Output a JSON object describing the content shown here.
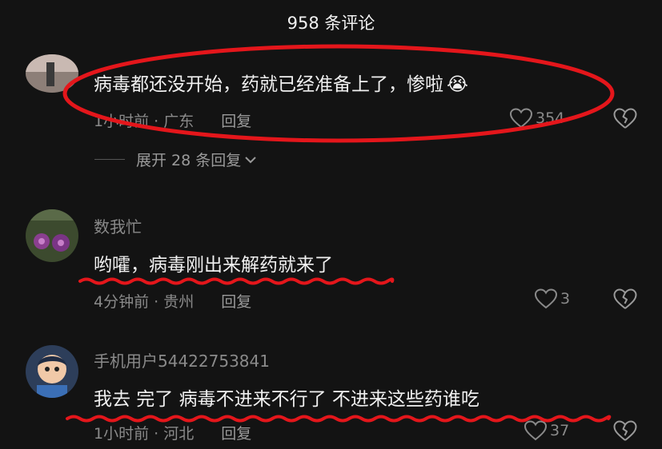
{
  "header": {
    "title": "958 条评论"
  },
  "comments": [
    {
      "username": "",
      "text": "病毒都还没开始，药就已经准备上了，惨啦",
      "emoji": "😭",
      "time": "1小时前",
      "location": "广东",
      "reply_label": "回复",
      "likes": "354",
      "expand_label": "展开 28 条回复"
    },
    {
      "username": "数我忙",
      "text": "哟嚯，病毒刚出来解药就来了",
      "time": "4分钟前",
      "location": "贵州",
      "reply_label": "回复",
      "likes": "3"
    },
    {
      "username": "手机用户54422753841",
      "text": "我去 完了 病毒不进来不行了 不进来这些药谁吃",
      "time": "1小时前",
      "location": "河北",
      "reply_label": "回复",
      "likes": "37"
    }
  ],
  "colors": {
    "annotation_red": "#e4161b",
    "background": "#131313"
  }
}
